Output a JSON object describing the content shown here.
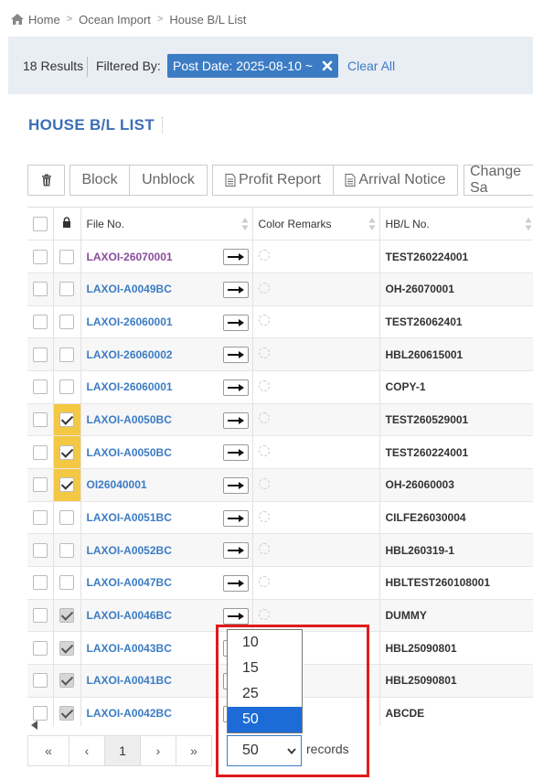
{
  "breadcrumb": {
    "home": "Home",
    "level1": "Ocean Import",
    "level2": "House B/L List"
  },
  "filter": {
    "results": "18 Results",
    "filtered_by": "Filtered By:",
    "chip_label": "Post Date: 2025-08-10 ~",
    "clear_all": "Clear All"
  },
  "page_title": "HOUSE B/L LIST",
  "toolbar": {
    "block": "Block",
    "unblock": "Unblock",
    "profit_report": "Profit Report",
    "arrival_notice": "Arrival Notice",
    "change_sales": "Change Sa"
  },
  "table": {
    "headers": {
      "file_no": "File No.",
      "color_remarks": "Color Remarks",
      "hbl_no": "HB/L No."
    },
    "rows": [
      {
        "file": "LAXOI-26070001",
        "hbl": "TEST260224001",
        "locked": false,
        "lock_style": "none",
        "visited": true
      },
      {
        "file": "LAXOI-A0049BC",
        "hbl": "OH-26070001",
        "locked": false,
        "lock_style": "none",
        "visited": false
      },
      {
        "file": "LAXOI-26060001",
        "hbl": "TEST26062401",
        "locked": false,
        "lock_style": "none",
        "visited": false
      },
      {
        "file": "LAXOI-26060002",
        "hbl": "HBL260615001",
        "locked": false,
        "lock_style": "none",
        "visited": false
      },
      {
        "file": "LAXOI-26060001",
        "hbl": "COPY-1",
        "locked": false,
        "lock_style": "none",
        "visited": false
      },
      {
        "file": "LAXOI-A0050BC",
        "hbl": "TEST260529001",
        "locked": true,
        "lock_style": "yellow",
        "visited": false
      },
      {
        "file": "LAXOI-A0050BC",
        "hbl": "TEST260224001",
        "locked": true,
        "lock_style": "yellow",
        "visited": false
      },
      {
        "file": "OI26040001",
        "hbl": "OH-26060003",
        "locked": true,
        "lock_style": "yellow",
        "visited": false
      },
      {
        "file": "LAXOI-A0051BC",
        "hbl": "CILFE26030004",
        "locked": false,
        "lock_style": "none",
        "visited": false
      },
      {
        "file": "LAXOI-A0052BC",
        "hbl": "HBL260319-1",
        "locked": false,
        "lock_style": "none",
        "visited": false
      },
      {
        "file": "LAXOI-A0047BC",
        "hbl": "HBLTEST260108001",
        "locked": false,
        "lock_style": "none",
        "visited": false
      },
      {
        "file": "LAXOI-A0046BC",
        "hbl": "DUMMY",
        "locked": true,
        "lock_style": "gray",
        "visited": false
      },
      {
        "file": "LAXOI-A0043BC",
        "hbl": "HBL25090801",
        "locked": true,
        "lock_style": "gray",
        "visited": false
      },
      {
        "file": "LAXOI-A0041BC",
        "hbl": "HBL25090801",
        "locked": true,
        "lock_style": "gray",
        "visited": false
      },
      {
        "file": "LAXOI-A0042BC",
        "hbl": "ABCDE",
        "locked": true,
        "lock_style": "gray",
        "visited": false
      }
    ]
  },
  "pager": {
    "first": "«",
    "prev": "‹",
    "current": "1",
    "next": "›",
    "last": "»"
  },
  "records": {
    "selected": "50",
    "label": "records",
    "options": [
      "10",
      "15",
      "25",
      "50"
    ]
  },
  "colors": {
    "accent": "#3c7cc4",
    "lock_yellow": "#f4c842",
    "highlight": "#e01b1b",
    "select_blue": "#1c6bd6"
  }
}
